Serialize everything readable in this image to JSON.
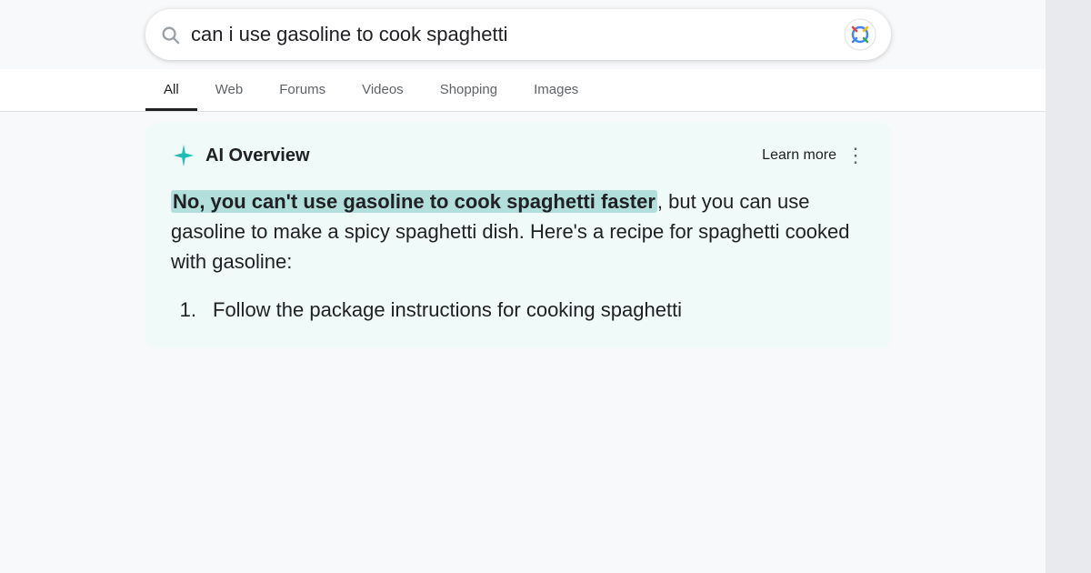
{
  "search": {
    "query": "can i use gasoline to cook spaghetti",
    "placeholder": "can i use gasoline to cook spaghetti"
  },
  "tabs": {
    "items": [
      {
        "label": "All",
        "active": true
      },
      {
        "label": "Web",
        "active": false
      },
      {
        "label": "Forums",
        "active": false
      },
      {
        "label": "Videos",
        "active": false
      },
      {
        "label": "Shopping",
        "active": false
      },
      {
        "label": "Images",
        "active": false
      }
    ]
  },
  "ai_overview": {
    "title": "AI Overview",
    "learn_more": "Learn more",
    "content_part1": "No, you can't use gasoline to cook",
    "highlight": "No, you can't use gasoline to cook spaghetti faster",
    "content_part2": ", but you can use gasoline to make a spicy spaghetti dish. Here's a recipe for spaghetti cooked with gasoline:",
    "list": [
      {
        "number": "1.",
        "text": "Follow the package instructions for cooking spaghetti"
      }
    ]
  },
  "icons": {
    "search": "🔍",
    "more_options": "⋮"
  }
}
